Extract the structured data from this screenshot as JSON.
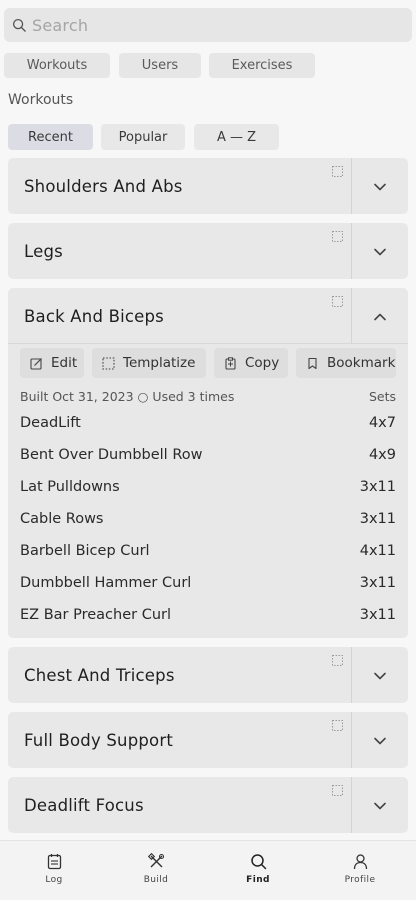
{
  "search": {
    "placeholder": "Search"
  },
  "type_tabs": [
    "Workouts",
    "Users",
    "Exercises"
  ],
  "section_label": "Workouts",
  "sort_tabs": {
    "items": [
      "Recent",
      "Popular",
      "A — Z"
    ],
    "selected": "Recent"
  },
  "workouts": [
    {
      "title": "Shoulders And Abs",
      "expanded": false
    },
    {
      "title": "Legs",
      "expanded": false
    },
    {
      "title": "Back And Biceps",
      "expanded": true,
      "actions": [
        "Edit",
        "Templatize",
        "Copy",
        "Bookmark"
      ],
      "built_text": "Built Oct 31, 2023 ○ Used 3 times",
      "sets_header": "Sets",
      "exercises": [
        {
          "name": "DeadLift",
          "sets": "4x7"
        },
        {
          "name": "Bent Over Dumbbell Row",
          "sets": "4x9"
        },
        {
          "name": "Lat Pulldowns",
          "sets": "3x11"
        },
        {
          "name": "Cable Rows",
          "sets": "3x11"
        },
        {
          "name": "Barbell Bicep Curl",
          "sets": "4x11"
        },
        {
          "name": "Dumbbell Hammer Curl",
          "sets": "3x11"
        },
        {
          "name": "EZ Bar Preacher Curl",
          "sets": "3x11"
        }
      ]
    },
    {
      "title": "Chest And Triceps",
      "expanded": false
    },
    {
      "title": "Full Body Support",
      "expanded": false
    },
    {
      "title": "Deadlift Focus",
      "expanded": false
    }
  ],
  "bottom_nav": {
    "items": [
      {
        "label": "Log",
        "icon": "clipboard-icon"
      },
      {
        "label": "Build",
        "icon": "build-tools-icon"
      },
      {
        "label": "Find",
        "icon": "search-icon"
      },
      {
        "label": "Profile",
        "icon": "person-icon"
      }
    ],
    "active": "Find"
  }
}
